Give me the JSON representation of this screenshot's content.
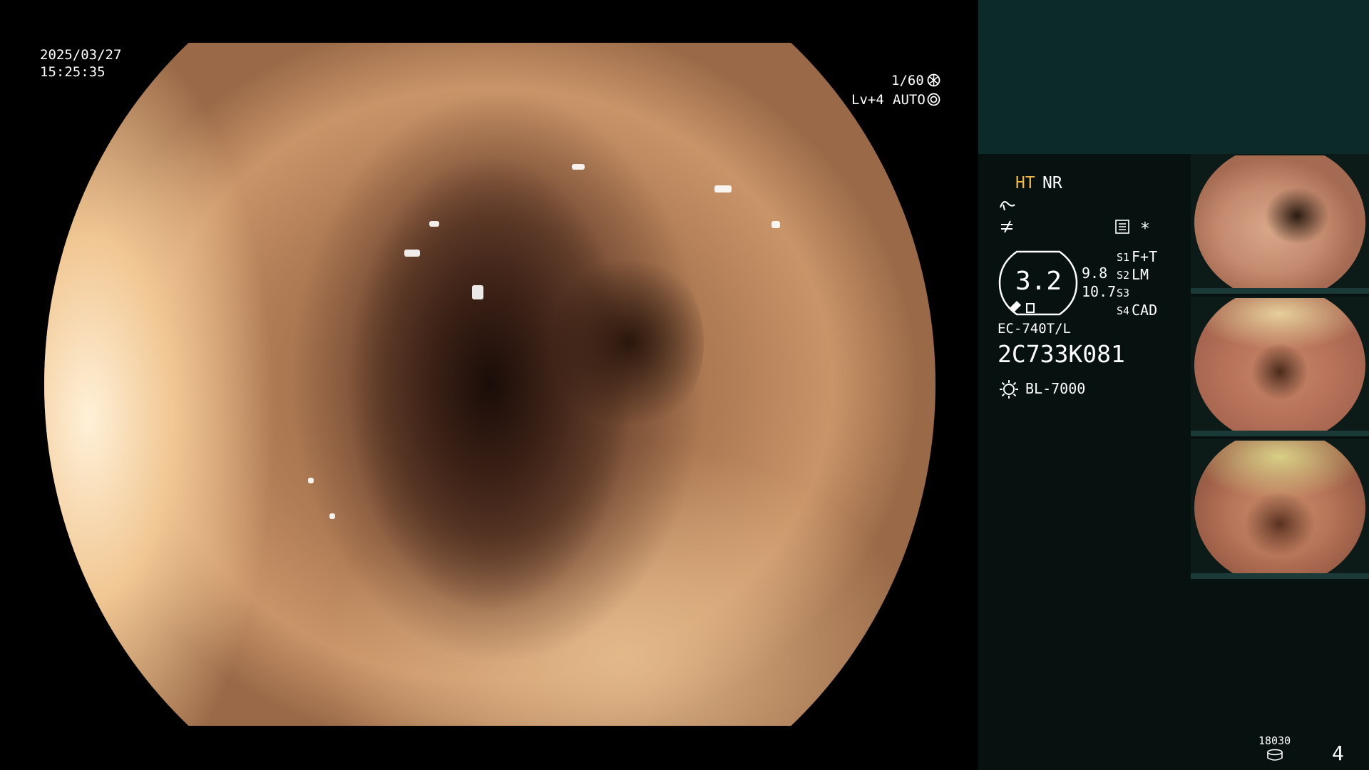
{
  "overlay": {
    "date": "2025/03/27",
    "time": "15:25:35",
    "shutter": "1/60",
    "level": "Lv+4",
    "mode": "AUTO"
  },
  "settings": {
    "ht_label": "HT",
    "nr_label": "NR",
    "gauge_value": "3.2",
    "value_a": "9.8",
    "value_b": "10.7",
    "switches": [
      {
        "key": "S1",
        "value": "F+T"
      },
      {
        "key": "S2",
        "value": "LM"
      },
      {
        "key": "S3",
        "value": ""
      },
      {
        "key": "S4",
        "value": "CAD"
      }
    ],
    "asterisk": "*",
    "scope_model": "EC-740T/L",
    "scope_serial": "2C733K081",
    "light_source": "BL-7000"
  },
  "footer": {
    "storage_count": "18030",
    "image_count": "4"
  },
  "colors": {
    "accent_ht": "#f0b849",
    "panel_bg": "#061110",
    "panel_top": "#0b2a28"
  },
  "icons": [
    "shutter-icon",
    "auto-mode-icon",
    "enhance-icon",
    "contrast-icon",
    "menu-icon",
    "gauge-icon",
    "light-source-icon",
    "storage-icon"
  ]
}
